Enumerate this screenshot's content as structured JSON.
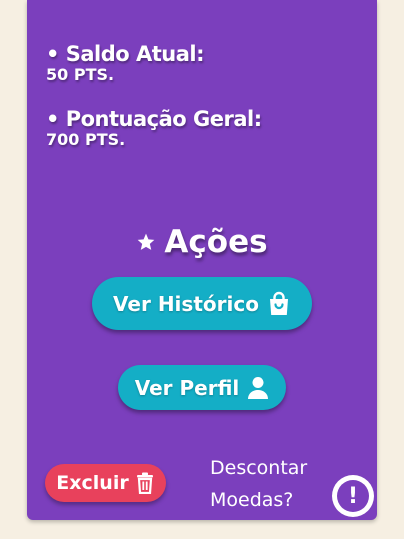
{
  "stats": {
    "saldo": {
      "label": "• Saldo Atual:",
      "value": "50 PTS."
    },
    "pontuacao": {
      "label": "• Pontuação Geral:",
      "value": "700 PTS."
    }
  },
  "actions": {
    "heading": "Ações",
    "heading_icon": "star-icon",
    "history_button": {
      "label": "Ver Histórico",
      "icon": "shopping-bag-icon"
    },
    "profile_button": {
      "label": "Ver Perfil",
      "icon": "user-icon"
    },
    "delete_button": {
      "label": "Excluir",
      "icon": "trash-icon"
    },
    "discount": {
      "line1": "Descontar",
      "line2": "Moedas?",
      "icon_label": "!",
      "icon": "exclamation-icon"
    }
  },
  "colors": {
    "page_background": "#f6efe2",
    "card_background": "#7b3fbd",
    "primary_button": "#14aec6",
    "danger_button": "#e8415c",
    "text": "#ffffff"
  }
}
